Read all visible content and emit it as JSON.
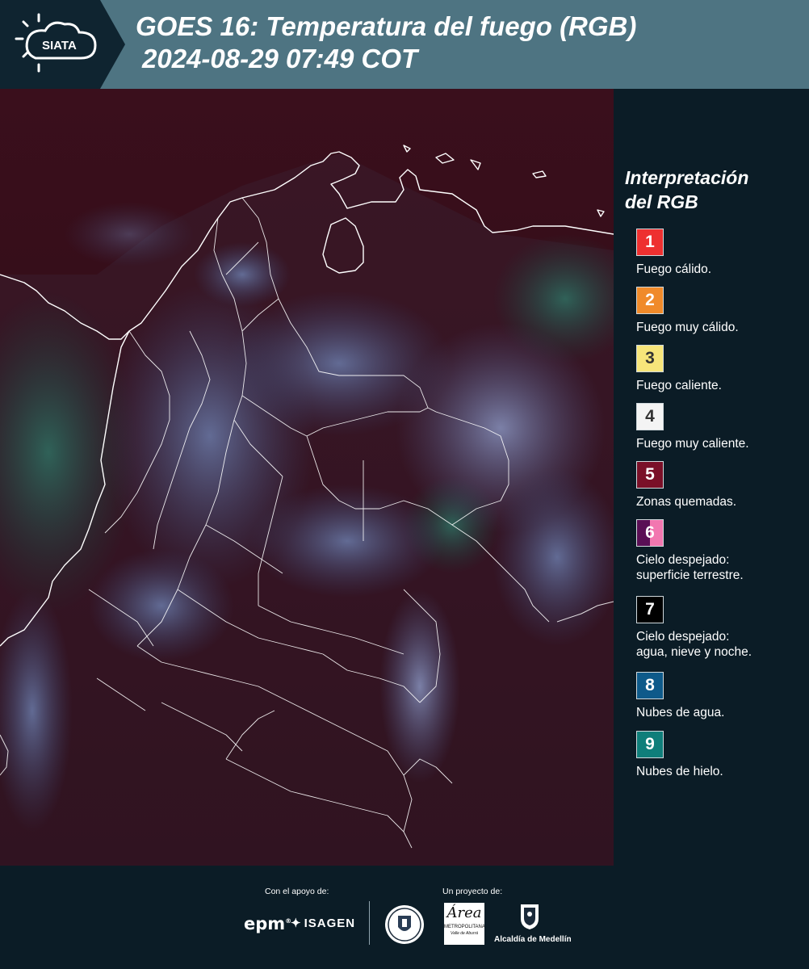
{
  "header": {
    "logo_text": "SIATA",
    "title_line1": "GOES 16: Temperatura del fuego (RGB)",
    "title_line2": "2024-08-29 07:49 COT",
    "background_color": "#4e7482"
  },
  "map": {
    "icon": "map-icon",
    "background_color": "#2a0a14",
    "border_color": "#ffffff"
  },
  "legend": {
    "title_line1": "Interpretación",
    "title_line2": "del RGB",
    "items": [
      {
        "number": "1",
        "label": "Fuego cálido.",
        "color": "#ee3030",
        "text_color": "#ffffff"
      },
      {
        "number": "2",
        "label": "Fuego muy cálido.",
        "color": "#f08a2a",
        "text_color": "#ffffff"
      },
      {
        "number": "3",
        "label": "Fuego caliente.",
        "color": "#f7e57a",
        "text_color": "#333333"
      },
      {
        "number": "4",
        "label": "Fuego muy caliente.",
        "color": "#f4f4f4",
        "text_color": "#333333"
      },
      {
        "number": "5",
        "label": "Zonas quemadas.",
        "color": "#7a1028",
        "text_color": "#ffffff"
      },
      {
        "number": "6",
        "label": "Cielo despejado:",
        "label2": "superficie terrestre.",
        "color": "#5a0f55",
        "color2": "#f277b0",
        "text_color": "#ffffff"
      },
      {
        "number": "7",
        "label": "Cielo despejado:",
        "label2": "agua, nieve y noche.",
        "color": "#000000",
        "text_color": "#ffffff"
      },
      {
        "number": "8",
        "label": "Nubes de agua.",
        "color": "#0e5a8a",
        "text_color": "#ffffff"
      },
      {
        "number": "9",
        "label": "Nubes de hielo.",
        "color": "#0f7e7a",
        "text_color": "#ffffff"
      }
    ]
  },
  "footer": {
    "support_label": "Con el apoyo de:",
    "project_label": "Un proyecto de:",
    "epm_logo": "epm",
    "isagen_logo": "ISAGEN",
    "area_logo_line1": "Área",
    "area_logo_line2": "METROPOLITANA",
    "area_logo_line3": "Valle de Aburrá",
    "alcaldia_logo": "Alcaldía de Medellín"
  }
}
